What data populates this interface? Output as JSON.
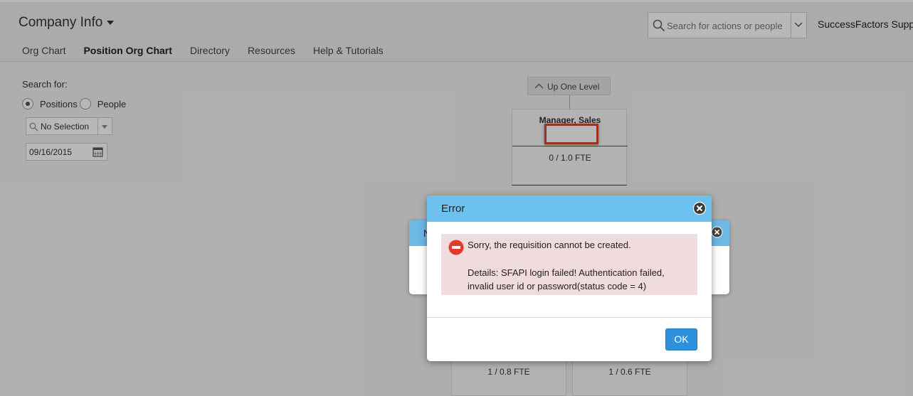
{
  "header": {
    "app_title": "Company Info",
    "search_placeholder": "Search for actions or people",
    "user_name": "SuccessFactors Suppo"
  },
  "nav": {
    "items": [
      {
        "label": "Org Chart",
        "active": false
      },
      {
        "label": "Position Org Chart",
        "active": true
      },
      {
        "label": "Directory",
        "active": false
      },
      {
        "label": "Resources",
        "active": false
      },
      {
        "label": "Help & Tutorials",
        "active": false
      }
    ]
  },
  "search_panel": {
    "label": "Search for:",
    "options": [
      {
        "label": "Positions",
        "selected": true
      },
      {
        "label": "People",
        "selected": false
      }
    ],
    "selection_value": "No Selection",
    "date_value": "09/16/2015"
  },
  "org_chart": {
    "up_button": "Up One Level",
    "position_title": "Manager, Sales",
    "position_fte": "0 / 1.0 FTE",
    "sub_positions": [
      {
        "fte": "1 / 0.8 FTE"
      },
      {
        "fte": "1 / 0.6 FTE"
      }
    ]
  },
  "background_dialog": {
    "title_partial": "N"
  },
  "error_dialog": {
    "title": "Error",
    "message": "Sorry, the requisition cannot be created.",
    "details": "Details: SFAPI login failed! Authentication failed, invalid user id or password(status code = 4)",
    "ok_label": "OK"
  },
  "colors": {
    "dialog_titlebar": "#6cc1ee",
    "message_background": "#f0dcdc",
    "error_icon": "#e53a2b",
    "ok_button": "#2d91dd",
    "highlight_border": "#d6482d"
  }
}
